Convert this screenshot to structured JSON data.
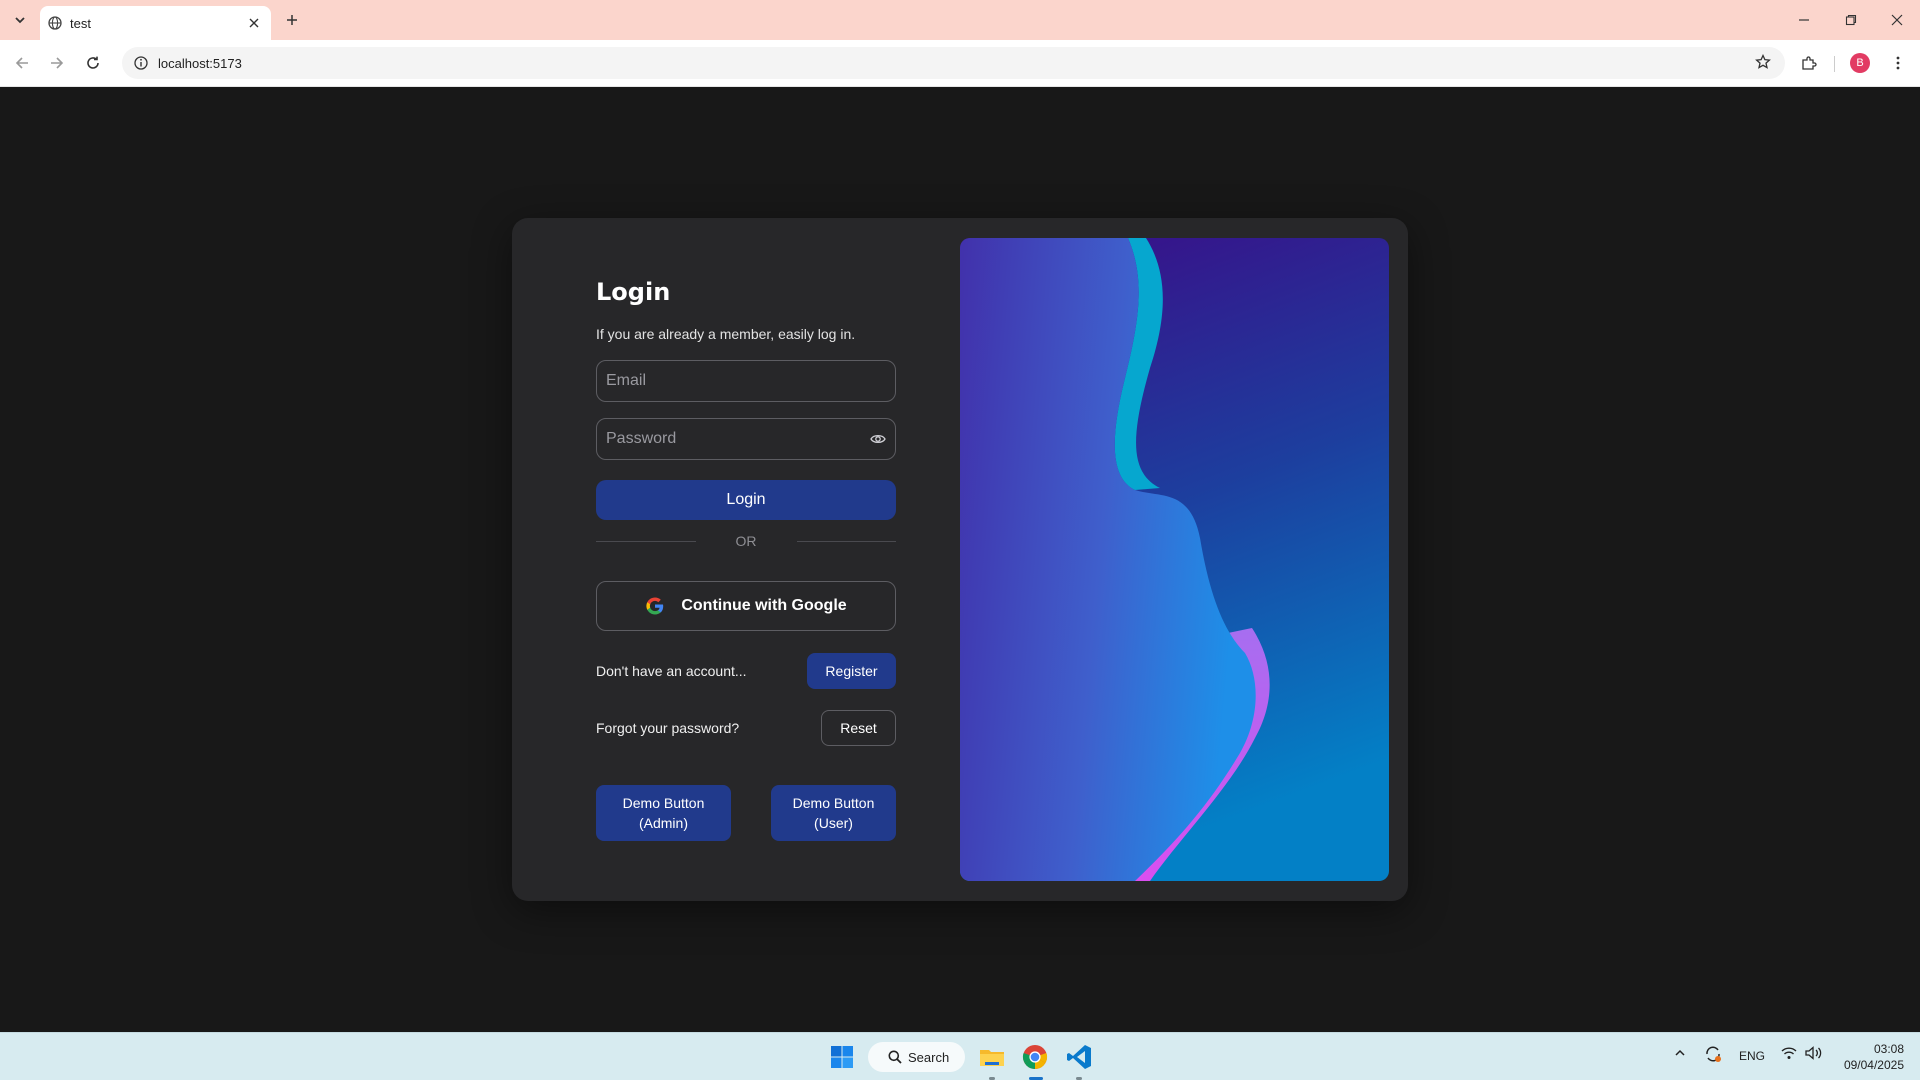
{
  "browser": {
    "tab_title": "test",
    "url": "localhost:5173",
    "profile_initial": "B"
  },
  "login": {
    "title": "Login",
    "subtitle": "If you are already a member, easily log in.",
    "email_placeholder": "Email",
    "password_placeholder": "Password",
    "login_button": "Login",
    "or_label": "OR",
    "google_button": "Continue with Google",
    "register_prompt": "Don't have an account...",
    "register_button": "Register",
    "forgot_prompt": "Forgot your password?",
    "reset_button": "Reset",
    "demo_admin_line1": "Demo Button",
    "demo_admin_line2": "(Admin)",
    "demo_user_line1": "Demo Button",
    "demo_user_line2": "(User)"
  },
  "taskbar": {
    "search_label": "Search",
    "language": "ENG",
    "time": "03:08",
    "date": "09/04/2025"
  },
  "colors": {
    "page_bg": "#181818",
    "card_bg": "#272729",
    "primary": "#213a8c",
    "tabbar": "#fbd5cc",
    "taskbar": "#d7ebf0"
  }
}
